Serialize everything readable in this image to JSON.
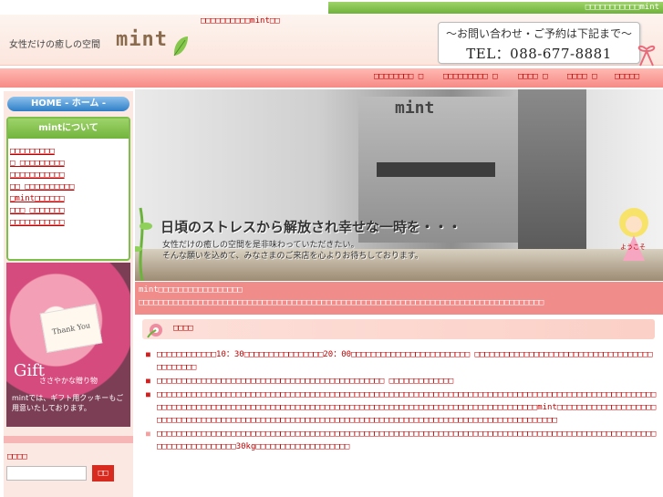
{
  "topbar": {
    "text": "□□□□□□□□□□□mint"
  },
  "header": {
    "tagline": "女性だけの癒しの空間",
    "logo": "mint",
    "center_text": "□□□□□□□□□□mint□□",
    "contact_line1": "～お問い合わせ・ご予約は下記まで～",
    "contact_tel": "TEL：088-677-8881"
  },
  "nav": {
    "items": [
      "□□□□□□□□ □",
      "□□□□□□□□□ □",
      "□□□□ □",
      "□□□□ □",
      "□□□□□"
    ]
  },
  "sidebar": {
    "home_label": "HOME - ホーム -",
    "about_head": "mintについて",
    "about_items": [
      "□□□□□□□□□",
      "□ □□□□□□□□□",
      "□□□□□□□□□□□",
      "□□ □□□□□□□□□□",
      "□mint□□□□□□",
      "□□□ □□□□□□□",
      "□□□□□□□□□□□"
    ],
    "gift_card": "Thank You",
    "gift_g": "Gift",
    "gift_tag": "ささやかな贈り物",
    "gift_desc": "mintでは、ギフト用クッキーもご用意いたしております。",
    "search_label": "□□□□",
    "search_value": "",
    "search_button": "□□"
  },
  "hero": {
    "sign": "mint",
    "headline": "日頃のストレスから解放され幸せな一時を・・・",
    "sub1": "女性だけの癒しの空間を是非味わっていただきたい。",
    "sub2": "そんな願いを込めて、みなさまのご来店を心よりお待ちしております。",
    "welcome": "ようこそ"
  },
  "notice": {
    "line1": "mint□□□□□□□□□□□□□□□□□",
    "line2": "□□□□□□□□□□□□□□□□□□□□□□□□□□□□□□□□□□□□□□□□□□□□□□□□□□□□□□□□□□□□□□□□□□□□□□□□□□□□□□□□□□"
  },
  "section": {
    "title": "□□□□"
  },
  "notes": [
    "□□□□□□□□□□□□10：30□□□□□□□□□□□□□□□□20：00□□□□□□□□□□□□□□□□□□□□□□□□ □□□□□□□□□□□□□□□□□□□□□□□□□□□□□□□□□□□□□□□□□□□□",
    "□□□□□□□□□□□□□□□□□□□□□□□□□□□□□□□□□□□□□□□□□□□□□□ □□□□□□□□□□□□□",
    "□□□□□□□□□□□□□□□□□□□□□□□□□□□□□□□□□□□□□□□□□□□□□□□□□□□□□□□□□□□□□□□□□□□□□□□□□□□□□□□□□□□□□□□□□□□□□□□□□□□□□□□□□□□□□□□□□□□□□□□□□□□□□□□□□□□□□□□□□□□□□□□□□□□□□□□□□□□□□□□□□□□□□□□□□□□□□□□□□□mint□□□□□□□□□□□□□□□□□□□□□□□□□□□□□□□□□□□□□□□□□□□□□□□□□□□□□□□□□□□□□□□□□□□□□□□□□□□□□□□□□□□□□□□□□□□□□□□□□□□□□",
    "□□□□□□□□□□□□□□□□□□□□□□□□□□□□□□□□□□□□□□□□□□□□□□□□□□□□□□□□□□□□□□□□□□□□□□□□□□□□□□□□□□□□□□□□□□□□□□□□□□□□□□□□□□□□□□□□□□□□□30kg□□□□□□□□□□□□□□□□□□□"
  ],
  "colors": {
    "accent_red": "#c00000",
    "green": "#7cc04a",
    "pink": "#f08c8a"
  }
}
